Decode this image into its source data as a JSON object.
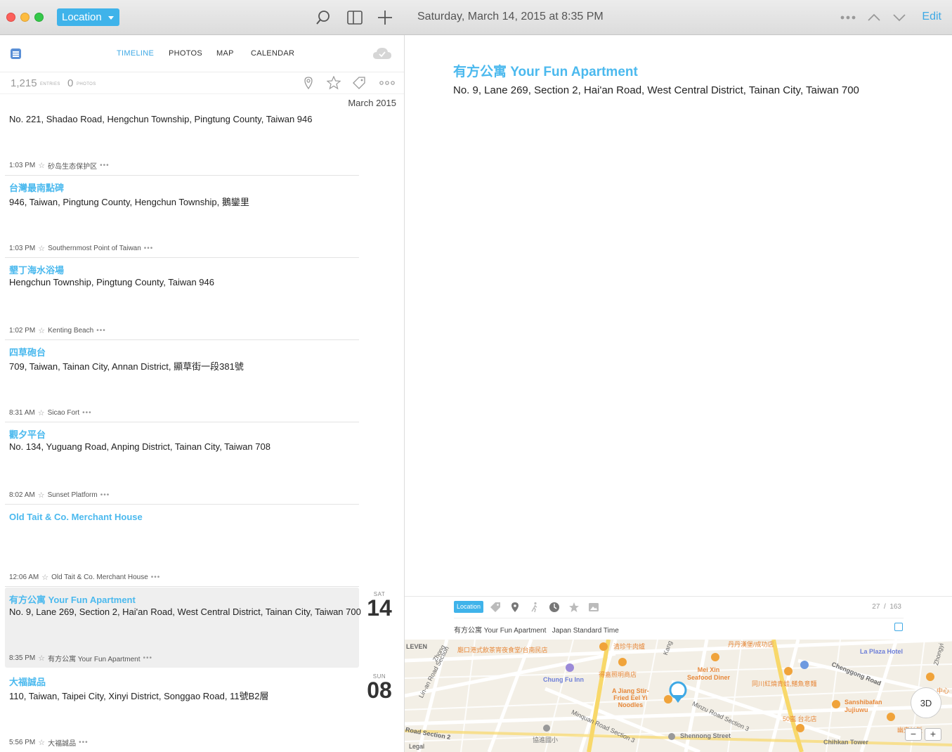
{
  "window": {
    "location_filter": "Location",
    "date_title": "Saturday, March 14, 2015 at 8:35 PM",
    "edit_label": "Edit"
  },
  "nav": {
    "tabs": [
      "TIMELINE",
      "PHOTOS",
      "MAP",
      "CALENDAR"
    ],
    "active_tab": "TIMELINE"
  },
  "stats": {
    "entries_count": "1,215",
    "entries_label": "ENTRIES",
    "photos_count": "0",
    "photos_label": "PHOTOS"
  },
  "month_label": "March 2015",
  "entries": [
    {
      "address": "No. 221, Shadao Road, Hengchun Township, Pingtung County, Taiwan 946",
      "time": "1:03 PM",
      "place": "砂岛生态保护区"
    },
    {
      "title": "台灣最南點碑",
      "address": "946, Taiwan, Pingtung County, Hengchun Township, 鵝鑾里",
      "time": "1:03 PM",
      "place": "Southernmost Point of Taiwan"
    },
    {
      "title": "墾丁海水浴場",
      "address": "Hengchun Township, Pingtung County, Taiwan 946",
      "time": "1:02 PM",
      "place": "Kenting Beach"
    },
    {
      "title": "四草砲台",
      "address": "709, Taiwan, Tainan City, Annan District, 顯草街一段381號",
      "time": "8:31 AM",
      "place": "Sicao Fort"
    },
    {
      "title": "觀夕平台",
      "address": "No. 134, Yuguang Road, Anping District, Tainan City, Taiwan 708",
      "time": "8:02 AM",
      "place": "Sunset Platform"
    },
    {
      "title": "Old Tait & Co. Merchant House",
      "address": "",
      "time": "12:06 AM",
      "place": "Old Tait & Co. Merchant House"
    },
    {
      "title": "有方公寓 Your Fun Apartment",
      "address": "No. 9, Lane 269, Section 2, Hai'an Road, West Central District, Tainan City, Taiwan 700",
      "time": "8:35 PM",
      "place": "有方公寓 Your Fun Apartment",
      "day_of_week": "SAT",
      "day": "14"
    },
    {
      "title": "大福誠品",
      "address": "110, Taiwan, Taipei City, Xinyi District, Songgao Road, 11號B2層",
      "time": "5:56 PM",
      "place": "大福誠品",
      "day_of_week": "SUN",
      "day": "08"
    }
  ],
  "detail": {
    "title": "有方公寓 Your Fun Apartment",
    "address": "No. 9, Lane 269, Section 2, Hai'an Road, West Central District, Tainan City, Taiwan 700",
    "tag": "Location",
    "counter_current": "27",
    "counter_sep": "/",
    "counter_total": "163",
    "place_name": "有方公寓 Your Fun Apartment",
    "timezone": "Japan Standard Time"
  },
  "map": {
    "labels": {
      "leven": "LEVEN",
      "lin_an": "Lin-an Road Section",
      "restaurant1": "廟口港式飲茶宵夜食堂/台南民店",
      "beef": "清珍牛肉爐",
      "chung_fu": "Chung Fu Inn",
      "tekka": "得嘉照明商店",
      "ajiang": "A Jiang Stir-\nFried Eel Yi\nNoodles",
      "mei_xin": "Mei Xin\nSeafood Diner",
      "danden": "丹丹漢堡/成功店",
      "chenggong": "Chenggong Road",
      "la_plaza": "La Plaza Hotel",
      "tongchuan": "同川紅燒青蛙,鱔魚意麵",
      "sanshibafan": "Sanshibafan\nJujiuwu",
      "mingzu": "Minzu Road Section 3",
      "minquan": "Minquan Road Section 3",
      "shennong": "Shennong Street",
      "school": "協進國小",
      "road_sec2": "Road Section 2",
      "fifty": "50嵐 台北店",
      "chihkan": "Chihkan Tower",
      "ghost": "幽鬼炒飯",
      "legal": "Legal",
      "kang": "Kang",
      "zhong": "Zhongyi",
      "center": "中心",
      "zhon2": "Zhong"
    },
    "compass_label": "3D",
    "zoom_out": "−",
    "zoom_in": "+"
  }
}
